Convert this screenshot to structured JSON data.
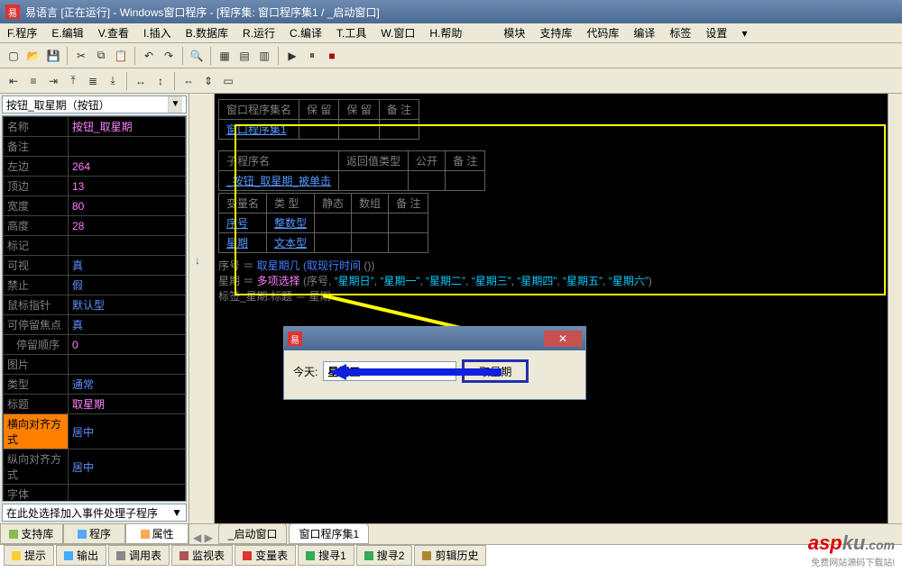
{
  "titlebar": {
    "app": "易语言",
    "state": "[正在运行]",
    "doc": "- Windows窗口程序 - [程序集: 窗口程序集1 / _启动窗口]"
  },
  "menu": {
    "items": [
      "F.程序",
      "E.编辑",
      "V.查看",
      "I.插入",
      "B.数据库",
      "R.运行",
      "C.编译",
      "T.工具",
      "W.窗口",
      "H.帮助"
    ],
    "right": [
      "模块",
      "支持库",
      "代码库",
      "编译",
      "标签",
      "设置"
    ]
  },
  "left_panel": {
    "combo": "按钮_取星期（按钮）",
    "event_placeholder": "在此处选择加入事件处理子程序",
    "tabs": [
      "支持库",
      "程序",
      "属性"
    ],
    "props": [
      {
        "k": "名称",
        "v": "按钮_取星期",
        "cls": "pink"
      },
      {
        "k": "备注",
        "v": ""
      },
      {
        "k": "左边",
        "v": "264",
        "cls": "pink"
      },
      {
        "k": "顶边",
        "v": "13",
        "cls": "pink"
      },
      {
        "k": "宽度",
        "v": "80",
        "cls": "pink"
      },
      {
        "k": "高度",
        "v": "28",
        "cls": "pink"
      },
      {
        "k": "标记",
        "v": ""
      },
      {
        "k": "可视",
        "v": "真",
        "cls": "blue"
      },
      {
        "k": "禁止",
        "v": "假",
        "cls": "blue"
      },
      {
        "k": "鼠标指针",
        "v": "默认型",
        "cls": "blue"
      },
      {
        "k": "可停留焦点",
        "v": "真",
        "cls": "blue"
      },
      {
        "k": "停留顺序",
        "v": "0",
        "cls": "pink",
        "sub": true
      },
      {
        "k": "图片",
        "v": ""
      },
      {
        "k": "类型",
        "v": "通常",
        "cls": "blue"
      },
      {
        "k": "标题",
        "v": "取星期",
        "cls": "pink"
      },
      {
        "k": "横向对齐方式",
        "v": "居中",
        "cls": "blue",
        "sel": true
      },
      {
        "k": "纵向对齐方式",
        "v": "居中",
        "cls": "blue"
      },
      {
        "k": "字体",
        "v": ""
      }
    ]
  },
  "code": {
    "top_table": {
      "headers": [
        "窗口程序集名",
        "保 留",
        "保 留",
        "备 注"
      ],
      "row": [
        "窗口程序集1",
        "",
        "",
        ""
      ]
    },
    "sub_table": {
      "headers": [
        "子程序名",
        "返回值类型",
        "公开",
        "备 注"
      ],
      "row": [
        "_按钮_取星期_被单击",
        "",
        "",
        ""
      ]
    },
    "var_table": {
      "headers": [
        "变量名",
        "类 型",
        "静态",
        "数组",
        "备 注"
      ],
      "rows": [
        [
          "序号",
          "整数型",
          "",
          "",
          ""
        ],
        [
          "星期",
          "文本型",
          "",
          "",
          ""
        ]
      ]
    },
    "line1_left": "序号 ＝ ",
    "line1_func": "取星期几",
    "line1_arg": " (取现行时间",
    "line1_end": " ())",
    "line2_left": "星期 ＝ ",
    "line2_func": "多项选择",
    "line2_open": " (序号, ",
    "line2_days": [
      "“星期日”",
      "“星期一”",
      "“星期二”",
      "“星期三”",
      "“星期四”",
      "“星期五”",
      "“星期六”"
    ],
    "line2_close": ")",
    "line3": "标签_星期.标题 ＝ 星期"
  },
  "runwin": {
    "label": "今天:",
    "value": "星期五",
    "button": "取星期",
    "close": "✕"
  },
  "doctabs": [
    "_启动窗口",
    "窗口程序集1"
  ],
  "bottomtabs": [
    "提示",
    "输出",
    "调用表",
    "监视表",
    "变量表",
    "搜寻1",
    "搜寻2",
    "剪辑历史"
  ],
  "watermark": {
    "a": "asp",
    "b": "ku",
    "c": ".com",
    "sub": "免费网站源码下载站!"
  }
}
